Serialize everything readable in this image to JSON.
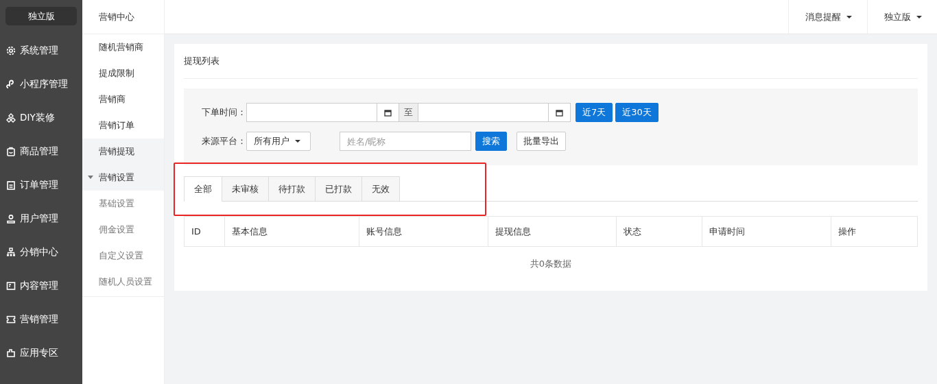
{
  "sidebar": {
    "brand": "独立版",
    "items": [
      {
        "label": "系统管理",
        "kind": "gear",
        "selected": false
      },
      {
        "label": "小程序管理",
        "kind": "link",
        "selected": false
      },
      {
        "label": "DIY装修",
        "kind": "diamond",
        "selected": false
      },
      {
        "label": "商品管理",
        "kind": "bag",
        "selected": false
      },
      {
        "label": "订单管理",
        "kind": "clipboard",
        "selected": false
      },
      {
        "label": "用户管理",
        "kind": "user",
        "selected": false
      },
      {
        "label": "分销中心",
        "kind": "tree",
        "selected": false
      },
      {
        "label": "内容管理",
        "kind": "doc",
        "selected": false
      },
      {
        "label": "营销管理",
        "kind": "ticket",
        "selected": false
      },
      {
        "label": "应用专区",
        "kind": "puzzle",
        "selected": false
      }
    ]
  },
  "submenu": {
    "title": "营销中心",
    "items": [
      {
        "label": "随机营销商",
        "selected": false
      },
      {
        "label": "提成限制",
        "selected": false
      },
      {
        "label": "营销商",
        "selected": false
      },
      {
        "label": "营销订单",
        "selected": false
      },
      {
        "label": "营销提现",
        "selected": true
      },
      {
        "label": "营销设置",
        "expanded": true,
        "children": [
          {
            "label": "基础设置",
            "selected": false
          },
          {
            "label": "佣金设置",
            "selected": false
          },
          {
            "label": "自定义设置",
            "selected": false
          },
          {
            "label": "随机人员设置",
            "selected": false
          }
        ]
      }
    ]
  },
  "topbar": {
    "menus": [
      "消息提醒",
      "独立版"
    ]
  },
  "panel": {
    "title": "提现列表",
    "filters": {
      "date_label": "下单时间：",
      "range_sep": "至",
      "quick_buttons": [
        "近7天",
        "近30天"
      ],
      "source_label": "来源平台：",
      "source_value": "所有用户",
      "name_placeholder": "姓名/昵称",
      "search_button": "搜索",
      "export_button": "批量导出"
    },
    "tabs": [
      {
        "label": "全部",
        "selected": true
      },
      {
        "label": "未审核",
        "selected": false
      },
      {
        "label": "待打款",
        "selected": false
      },
      {
        "label": "已打款",
        "selected": false
      },
      {
        "label": "无效",
        "selected": false
      }
    ],
    "table": {
      "columns": [
        "ID",
        "基本信息",
        "账号信息",
        "提现信息",
        "状态",
        "申请时间",
        "操作"
      ],
      "empty_text": "共0条数据"
    }
  }
}
